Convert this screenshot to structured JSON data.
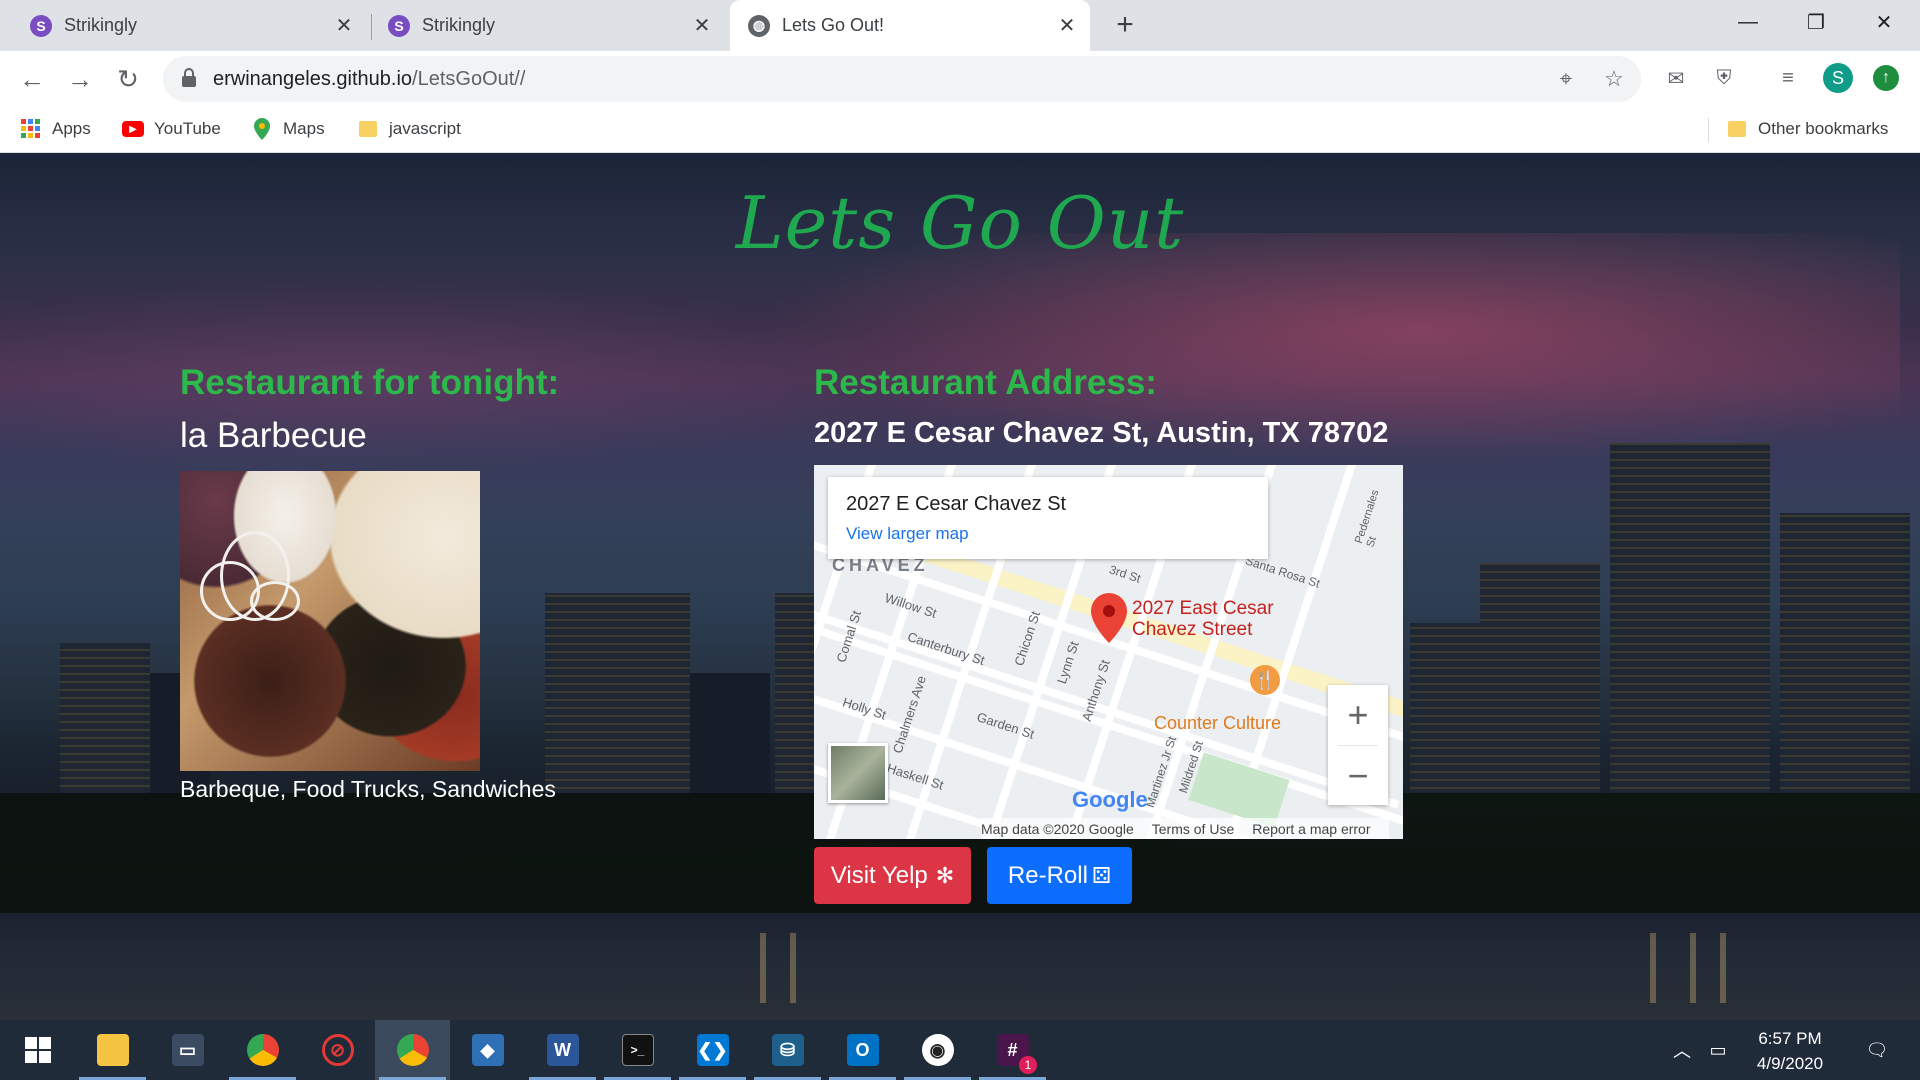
{
  "browser": {
    "tabs": [
      {
        "title": "Strikingly",
        "favicon": "S"
      },
      {
        "title": "Strikingly",
        "favicon": "S"
      },
      {
        "title": "Lets Go Out!",
        "favicon": "globe-icon"
      }
    ],
    "url_domain": "erwinangeles.github.io",
    "url_path": "/LetsGoOut//",
    "profile_initial": "S",
    "bookmarks": [
      {
        "label": "Apps",
        "icon": "apps-grid-icon"
      },
      {
        "label": "YouTube",
        "icon": "youtube-icon"
      },
      {
        "label": "Maps",
        "icon": "maps-pin-icon"
      },
      {
        "label": "javascript",
        "icon": "folder-icon"
      }
    ],
    "other_bookmarks": "Other bookmarks"
  },
  "page": {
    "title": "Lets Go Out",
    "restaurant_heading": "Restaurant for tonight:",
    "restaurant_name": "la Barbecue",
    "categories": "Barbeque, Food Trucks, Sandwiches",
    "address_heading": "Restaurant Address:",
    "address": "2027 E Cesar Chavez St, Austin, TX 78702",
    "visit_yelp": "Visit Yelp",
    "reroll": "Re-Roll"
  },
  "map": {
    "card_address": "2027 E Cesar Chavez St",
    "card_link": "View larger map",
    "pin_label_line1": "2027 East Cesar",
    "pin_label_line2": "Chavez Street",
    "poi": "Counter Culture",
    "district": "CHAVEZ",
    "streets": [
      "Willow St",
      "Canterbury St",
      "Holly St",
      "Garden St",
      "Chicon St",
      "Lynn St",
      "Anthony St",
      "Comal St",
      "Chalmers Ave",
      "Pedernales St",
      "Santa Rosa St",
      "3rd St",
      "Haskell St",
      "Martinez Jr St",
      "Mildred St"
    ],
    "zoom_in": "+",
    "zoom_out": "−",
    "logo": "Google",
    "footer": [
      "Map data ©2020 Google",
      "Terms of Use",
      "Report a map error"
    ]
  },
  "taskbar": {
    "time": "6:57 PM",
    "date": "4/9/2020",
    "notification_count": "1"
  }
}
